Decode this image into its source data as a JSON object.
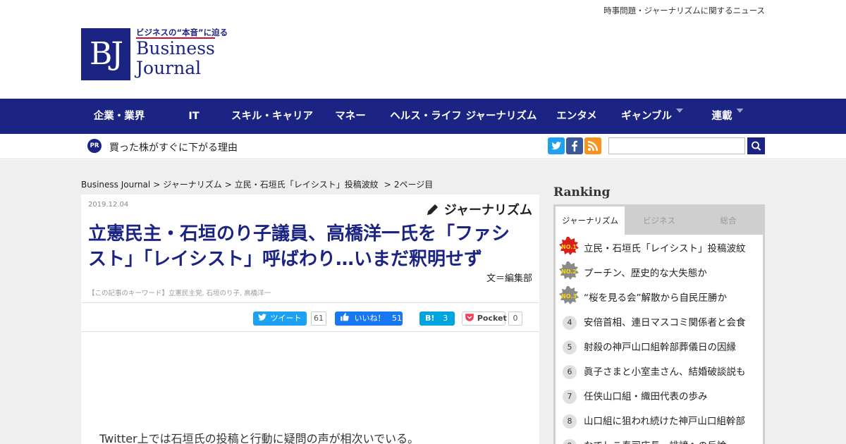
{
  "header": {
    "tagline": "時事問題・ジャーナリズムに関するニュース",
    "logo_catch": "ビジネスの“本音”に迫る",
    "logo_mark": "BJ",
    "logo_name_1": "Business",
    "logo_name_2": "Journal",
    "brand_color": "#1b2483"
  },
  "nav": {
    "items": [
      {
        "label": "企業・業界"
      },
      {
        "label": "IT"
      },
      {
        "label": "スキル・キャリア"
      },
      {
        "label": "マネー"
      },
      {
        "label": "ヘルス・ライフ"
      },
      {
        "label": "ジャーナリズム"
      },
      {
        "label": "エンタメ"
      },
      {
        "label": "ギャンブル"
      },
      {
        "label": "連載"
      }
    ]
  },
  "subbar": {
    "pr_badge": "PR",
    "pr_link": "買った株がすぐに下がる理由",
    "social_icons": [
      "twitter-icon",
      "facebook-icon",
      "rss-icon"
    ],
    "search_placeholder": ""
  },
  "breadcrumb": {
    "items": [
      "Business Journal",
      ">",
      "ジャーナリズム",
      ">",
      "立民・石垣氏「レイシスト」投稿波紋",
      ">",
      "2ページ目"
    ]
  },
  "article": {
    "date": "2019.12.04",
    "category": "ジャーナリズム",
    "headline": "立憲民主・石垣のり子議員、高橋洋一氏を「ファシスト」「レイシスト」呼ばわり…いまだ釈明せず",
    "byline": "文＝編集部",
    "keywords": "【この記事のキーワード】立憲民主党, 石垣のり子, 高橋洋一",
    "body_first_line": "Twitter上では石垣氏の投稿と行動に疑問の声が相次いでいる。"
  },
  "share": {
    "tweet_label": "ツイート",
    "tweet_count": "61",
    "like_label": "いいね！",
    "like_count": "51",
    "hatena_label": "B!",
    "hatena_count": "3",
    "pocket_label": "Pocket",
    "pocket_count": "0"
  },
  "ranking": {
    "title": "Ranking",
    "tabs": [
      "ジャーナリズム",
      "ビジネス",
      "総合"
    ],
    "items": [
      {
        "rank": "NO.1",
        "text": "立民・石垣氏「レイシスト」投稿波紋"
      },
      {
        "rank": "NO.2",
        "text": "プーチン、歴史的な大失態か"
      },
      {
        "rank": "NO.3",
        "text": "“桜を見る会”解散から自民圧勝か"
      },
      {
        "rank": "4",
        "text": "安倍首相、連日マスコミ関係者と会食"
      },
      {
        "rank": "5",
        "text": "射殺の神戸山口組幹部葬儀日の因縁"
      },
      {
        "rank": "6",
        "text": "眞子さまと小室圭さん、結婚破談説も"
      },
      {
        "rank": "7",
        "text": "任侠山口組・織田代表の歩み"
      },
      {
        "rank": "8",
        "text": "山口組に狙われ続けた神戸山口組幹部"
      },
      {
        "rank": "9",
        "text": "なでしこ寿司店長、誹謗への反論"
      }
    ]
  }
}
